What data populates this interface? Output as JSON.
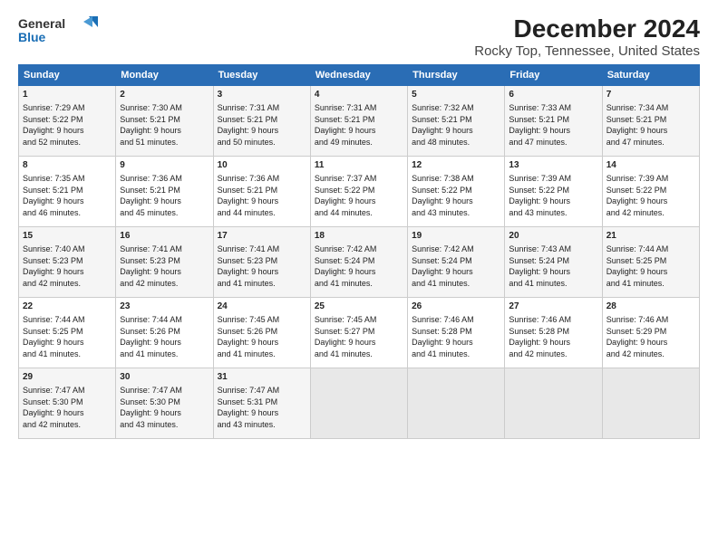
{
  "header": {
    "logo_line1": "General",
    "logo_line2": "Blue",
    "title": "December 2024",
    "subtitle": "Rocky Top, Tennessee, United States"
  },
  "columns": [
    "Sunday",
    "Monday",
    "Tuesday",
    "Wednesday",
    "Thursday",
    "Friday",
    "Saturday"
  ],
  "weeks": [
    [
      {
        "day": "1",
        "lines": [
          "Sunrise: 7:29 AM",
          "Sunset: 5:22 PM",
          "Daylight: 9 hours",
          "and 52 minutes."
        ]
      },
      {
        "day": "2",
        "lines": [
          "Sunrise: 7:30 AM",
          "Sunset: 5:21 PM",
          "Daylight: 9 hours",
          "and 51 minutes."
        ]
      },
      {
        "day": "3",
        "lines": [
          "Sunrise: 7:31 AM",
          "Sunset: 5:21 PM",
          "Daylight: 9 hours",
          "and 50 minutes."
        ]
      },
      {
        "day": "4",
        "lines": [
          "Sunrise: 7:31 AM",
          "Sunset: 5:21 PM",
          "Daylight: 9 hours",
          "and 49 minutes."
        ]
      },
      {
        "day": "5",
        "lines": [
          "Sunrise: 7:32 AM",
          "Sunset: 5:21 PM",
          "Daylight: 9 hours",
          "and 48 minutes."
        ]
      },
      {
        "day": "6",
        "lines": [
          "Sunrise: 7:33 AM",
          "Sunset: 5:21 PM",
          "Daylight: 9 hours",
          "and 47 minutes."
        ]
      },
      {
        "day": "7",
        "lines": [
          "Sunrise: 7:34 AM",
          "Sunset: 5:21 PM",
          "Daylight: 9 hours",
          "and 47 minutes."
        ]
      }
    ],
    [
      {
        "day": "8",
        "lines": [
          "Sunrise: 7:35 AM",
          "Sunset: 5:21 PM",
          "Daylight: 9 hours",
          "and 46 minutes."
        ]
      },
      {
        "day": "9",
        "lines": [
          "Sunrise: 7:36 AM",
          "Sunset: 5:21 PM",
          "Daylight: 9 hours",
          "and 45 minutes."
        ]
      },
      {
        "day": "10",
        "lines": [
          "Sunrise: 7:36 AM",
          "Sunset: 5:21 PM",
          "Daylight: 9 hours",
          "and 44 minutes."
        ]
      },
      {
        "day": "11",
        "lines": [
          "Sunrise: 7:37 AM",
          "Sunset: 5:22 PM",
          "Daylight: 9 hours",
          "and 44 minutes."
        ]
      },
      {
        "day": "12",
        "lines": [
          "Sunrise: 7:38 AM",
          "Sunset: 5:22 PM",
          "Daylight: 9 hours",
          "and 43 minutes."
        ]
      },
      {
        "day": "13",
        "lines": [
          "Sunrise: 7:39 AM",
          "Sunset: 5:22 PM",
          "Daylight: 9 hours",
          "and 43 minutes."
        ]
      },
      {
        "day": "14",
        "lines": [
          "Sunrise: 7:39 AM",
          "Sunset: 5:22 PM",
          "Daylight: 9 hours",
          "and 42 minutes."
        ]
      }
    ],
    [
      {
        "day": "15",
        "lines": [
          "Sunrise: 7:40 AM",
          "Sunset: 5:23 PM",
          "Daylight: 9 hours",
          "and 42 minutes."
        ]
      },
      {
        "day": "16",
        "lines": [
          "Sunrise: 7:41 AM",
          "Sunset: 5:23 PM",
          "Daylight: 9 hours",
          "and 42 minutes."
        ]
      },
      {
        "day": "17",
        "lines": [
          "Sunrise: 7:41 AM",
          "Sunset: 5:23 PM",
          "Daylight: 9 hours",
          "and 41 minutes."
        ]
      },
      {
        "day": "18",
        "lines": [
          "Sunrise: 7:42 AM",
          "Sunset: 5:24 PM",
          "Daylight: 9 hours",
          "and 41 minutes."
        ]
      },
      {
        "day": "19",
        "lines": [
          "Sunrise: 7:42 AM",
          "Sunset: 5:24 PM",
          "Daylight: 9 hours",
          "and 41 minutes."
        ]
      },
      {
        "day": "20",
        "lines": [
          "Sunrise: 7:43 AM",
          "Sunset: 5:24 PM",
          "Daylight: 9 hours",
          "and 41 minutes."
        ]
      },
      {
        "day": "21",
        "lines": [
          "Sunrise: 7:44 AM",
          "Sunset: 5:25 PM",
          "Daylight: 9 hours",
          "and 41 minutes."
        ]
      }
    ],
    [
      {
        "day": "22",
        "lines": [
          "Sunrise: 7:44 AM",
          "Sunset: 5:25 PM",
          "Daylight: 9 hours",
          "and 41 minutes."
        ]
      },
      {
        "day": "23",
        "lines": [
          "Sunrise: 7:44 AM",
          "Sunset: 5:26 PM",
          "Daylight: 9 hours",
          "and 41 minutes."
        ]
      },
      {
        "day": "24",
        "lines": [
          "Sunrise: 7:45 AM",
          "Sunset: 5:26 PM",
          "Daylight: 9 hours",
          "and 41 minutes."
        ]
      },
      {
        "day": "25",
        "lines": [
          "Sunrise: 7:45 AM",
          "Sunset: 5:27 PM",
          "Daylight: 9 hours",
          "and 41 minutes."
        ]
      },
      {
        "day": "26",
        "lines": [
          "Sunrise: 7:46 AM",
          "Sunset: 5:28 PM",
          "Daylight: 9 hours",
          "and 41 minutes."
        ]
      },
      {
        "day": "27",
        "lines": [
          "Sunrise: 7:46 AM",
          "Sunset: 5:28 PM",
          "Daylight: 9 hours",
          "and 42 minutes."
        ]
      },
      {
        "day": "28",
        "lines": [
          "Sunrise: 7:46 AM",
          "Sunset: 5:29 PM",
          "Daylight: 9 hours",
          "and 42 minutes."
        ]
      }
    ],
    [
      {
        "day": "29",
        "lines": [
          "Sunrise: 7:47 AM",
          "Sunset: 5:30 PM",
          "Daylight: 9 hours",
          "and 42 minutes."
        ]
      },
      {
        "day": "30",
        "lines": [
          "Sunrise: 7:47 AM",
          "Sunset: 5:30 PM",
          "Daylight: 9 hours",
          "and 43 minutes."
        ]
      },
      {
        "day": "31",
        "lines": [
          "Sunrise: 7:47 AM",
          "Sunset: 5:31 PM",
          "Daylight: 9 hours",
          "and 43 minutes."
        ]
      },
      {
        "day": "",
        "lines": []
      },
      {
        "day": "",
        "lines": []
      },
      {
        "day": "",
        "lines": []
      },
      {
        "day": "",
        "lines": []
      }
    ]
  ]
}
